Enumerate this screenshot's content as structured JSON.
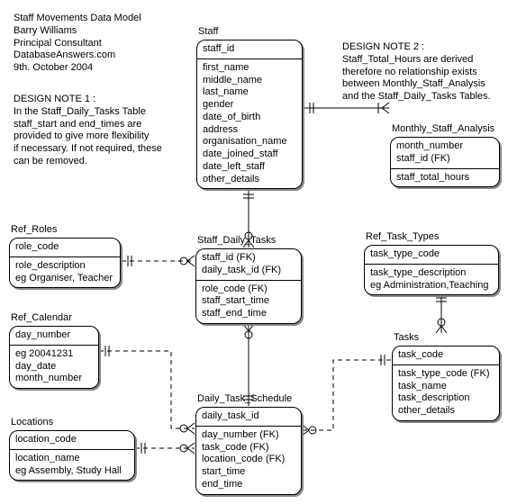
{
  "header": {
    "title": "Staff Movements Data Model",
    "author": "Barry Williams",
    "role": "Principal Consultant",
    "site": "DatabaseAnswers.com",
    "date": "9th. October 2004"
  },
  "note1": {
    "title": "DESIGN NOTE 1 :",
    "body": "In the Staff_Daily_Tasks Table\nstaff_start and end_times are\nprovided to give more flexibility\nif necessary. If not required, these\ncan be removed."
  },
  "note2": {
    "title": "DESIGN NOTE 2 :",
    "body": "Staff_Total_Hours are derived\ntherefore no relationship exists\nbetween Monthly_Staff_Analysis\nand the Staff_Daily_Tasks Tables."
  },
  "entities": {
    "staff": {
      "name": "Staff",
      "pk": "staff_id",
      "attrs": "first_name\nmiddle_name\nlast_name\ngender\ndate_of_birth\naddress\norganisation_name\ndate_joined_staff\ndate_left_staff\nother_details"
    },
    "monthly": {
      "name": "Monthly_Staff_Analysis",
      "pk": "month_number\nstaff_id (FK)",
      "attrs": "staff_total_hours"
    },
    "roles": {
      "name": "Ref_Roles",
      "pk": "role_code",
      "attrs": "role_description\neg Organiser, Teacher"
    },
    "sdt": {
      "name": "Staff_Daily_Tasks",
      "pk": "staff_id (FK)\ndaily_task_id (FK)",
      "attrs": "role_code (FK)\nstaff_start_time\nstaff_end_time"
    },
    "tasktypes": {
      "name": "Ref_Task_Types",
      "pk": "task_type_code",
      "attrs": "task_type_description\neg Administration,Teaching"
    },
    "calendar": {
      "name": "Ref_Calendar",
      "pk": "day_number",
      "attrs": "eg 20041231\nday_date\nmonth_number"
    },
    "tasks": {
      "name": "Tasks",
      "pk": "task_code",
      "attrs": "task_type_code (FK)\ntask_name\ntask_description\nother_details"
    },
    "locations": {
      "name": "Locations",
      "pk": "location_code",
      "attrs": "location_name\neg Assembly, Study Hall"
    },
    "dts": {
      "name": "Daily_Task_Schedule",
      "pk": "daily_task_id",
      "attrs": "day_number (FK)\ntask_code (FK)\nlocation_code (FK)\nstart_time\nend_time"
    }
  },
  "chart_data": {
    "type": "entity-relationship",
    "title": "Staff Movements Data Model",
    "entities": [
      {
        "name": "Staff",
        "pk": [
          "staff_id"
        ],
        "attrs": [
          "first_name",
          "middle_name",
          "last_name",
          "gender",
          "date_of_birth",
          "address",
          "organisation_name",
          "date_joined_staff",
          "date_left_staff",
          "other_details"
        ]
      },
      {
        "name": "Monthly_Staff_Analysis",
        "pk": [
          "month_number",
          "staff_id (FK)"
        ],
        "attrs": [
          "staff_total_hours"
        ]
      },
      {
        "name": "Ref_Roles",
        "pk": [
          "role_code"
        ],
        "attrs": [
          "role_description"
        ],
        "example": "Organiser, Teacher"
      },
      {
        "name": "Staff_Daily_Tasks",
        "pk": [
          "staff_id (FK)",
          "daily_task_id (FK)"
        ],
        "attrs": [
          "role_code (FK)",
          "staff_start_time",
          "staff_end_time"
        ]
      },
      {
        "name": "Ref_Task_Types",
        "pk": [
          "task_type_code"
        ],
        "attrs": [
          "task_type_description"
        ],
        "example": "Administration,Teaching"
      },
      {
        "name": "Ref_Calendar",
        "pk": [
          "day_number"
        ],
        "attrs": [
          "day_date",
          "month_number"
        ],
        "example": "20041231"
      },
      {
        "name": "Tasks",
        "pk": [
          "task_code"
        ],
        "attrs": [
          "task_type_code (FK)",
          "task_name",
          "task_description",
          "other_details"
        ]
      },
      {
        "name": "Locations",
        "pk": [
          "location_code"
        ],
        "attrs": [
          "location_name"
        ],
        "example": "Assembly, Study Hall"
      },
      {
        "name": "Daily_Task_Schedule",
        "pk": [
          "daily_task_id"
        ],
        "attrs": [
          "day_number (FK)",
          "task_code (FK)",
          "location_code (FK)",
          "start_time",
          "end_time"
        ]
      }
    ],
    "relationships": [
      {
        "from": "Staff",
        "to": "Staff_Daily_Tasks",
        "type": "identifying",
        "cardinality": "1:N"
      },
      {
        "from": "Staff",
        "to": "Monthly_Staff_Analysis",
        "type": "identifying",
        "cardinality": "1:N"
      },
      {
        "from": "Ref_Roles",
        "to": "Staff_Daily_Tasks",
        "type": "non-identifying",
        "cardinality": "1:N"
      },
      {
        "from": "Ref_Task_Types",
        "to": "Tasks",
        "type": "non-identifying",
        "cardinality": "1:N"
      },
      {
        "from": "Ref_Calendar",
        "to": "Daily_Task_Schedule",
        "type": "non-identifying",
        "cardinality": "1:N"
      },
      {
        "from": "Tasks",
        "to": "Daily_Task_Schedule",
        "type": "non-identifying",
        "cardinality": "1:N"
      },
      {
        "from": "Locations",
        "to": "Daily_Task_Schedule",
        "type": "non-identifying",
        "cardinality": "1:N"
      },
      {
        "from": "Daily_Task_Schedule",
        "to": "Staff_Daily_Tasks",
        "type": "identifying",
        "cardinality": "1:N"
      }
    ]
  }
}
